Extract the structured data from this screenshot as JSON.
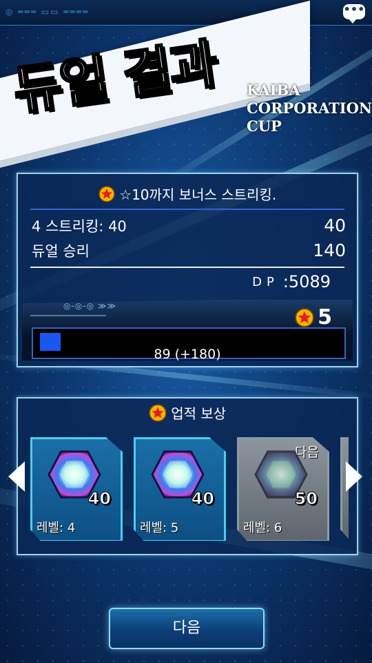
{
  "header": {
    "title": "듀얼 결과",
    "cup_line1": "KAIBA",
    "cup_line2": "CORPORATION",
    "cup_line3": "CUP",
    "chat_icon": "chat-bubble-icon"
  },
  "result": {
    "streak_bonus": "☆10까지 보너스 스트리킹.",
    "rows": [
      {
        "label": "4 스트리킹: 40",
        "value": "40"
      },
      {
        "label": "듀얼 승리",
        "value": "140"
      }
    ],
    "dp_label": "DP",
    "dp_sep": ":",
    "dp_value": "5089",
    "rank": "5",
    "progress_text": "89 (+180)",
    "progress_fraction": 0.07
  },
  "rewards": {
    "title": "업적 보상",
    "cards": [
      {
        "count": "40",
        "level": "레벨: 4",
        "locked": false,
        "tag": ""
      },
      {
        "count": "40",
        "level": "레벨: 5",
        "locked": false,
        "tag": ""
      },
      {
        "count": "50",
        "level": "레벨: 6",
        "locked": true,
        "tag": "다음"
      }
    ]
  },
  "footer": {
    "next_label": "다음"
  },
  "colors": {
    "accent": "#48d0f0",
    "panel_border": "#9fd4ee",
    "progress": "#1b56f0"
  }
}
